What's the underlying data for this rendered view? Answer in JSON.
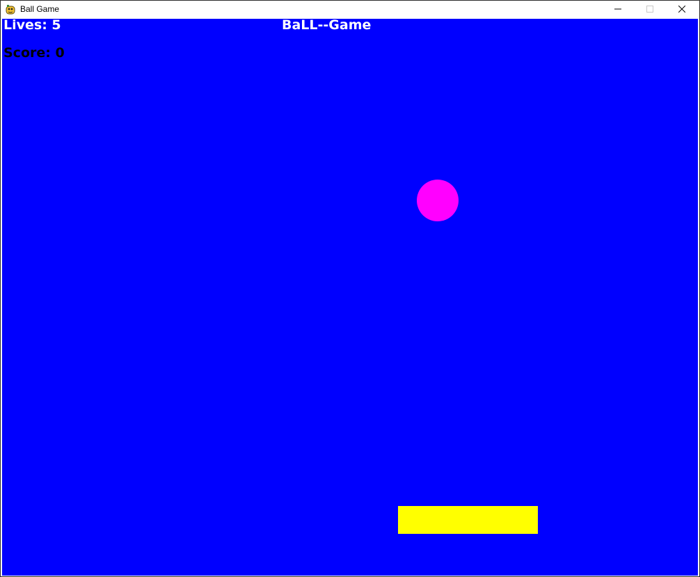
{
  "window": {
    "title": "Ball Game",
    "icon": "pygame-snake-icon",
    "controls": {
      "minimize_icon": "minimize-icon",
      "maximize_icon": "maximize-icon",
      "close_icon": "close-icon"
    }
  },
  "hud": {
    "lives_text": "Lives: 5",
    "score_text": "Score: 0",
    "game_title": "BaLL--Game"
  },
  "colors": {
    "background": "#0000ff",
    "ball": "#ff00ff",
    "paddle": "#ffff00",
    "lives_text": "#ffffff",
    "score_text": "#000000",
    "title_text": "#ffffff"
  }
}
